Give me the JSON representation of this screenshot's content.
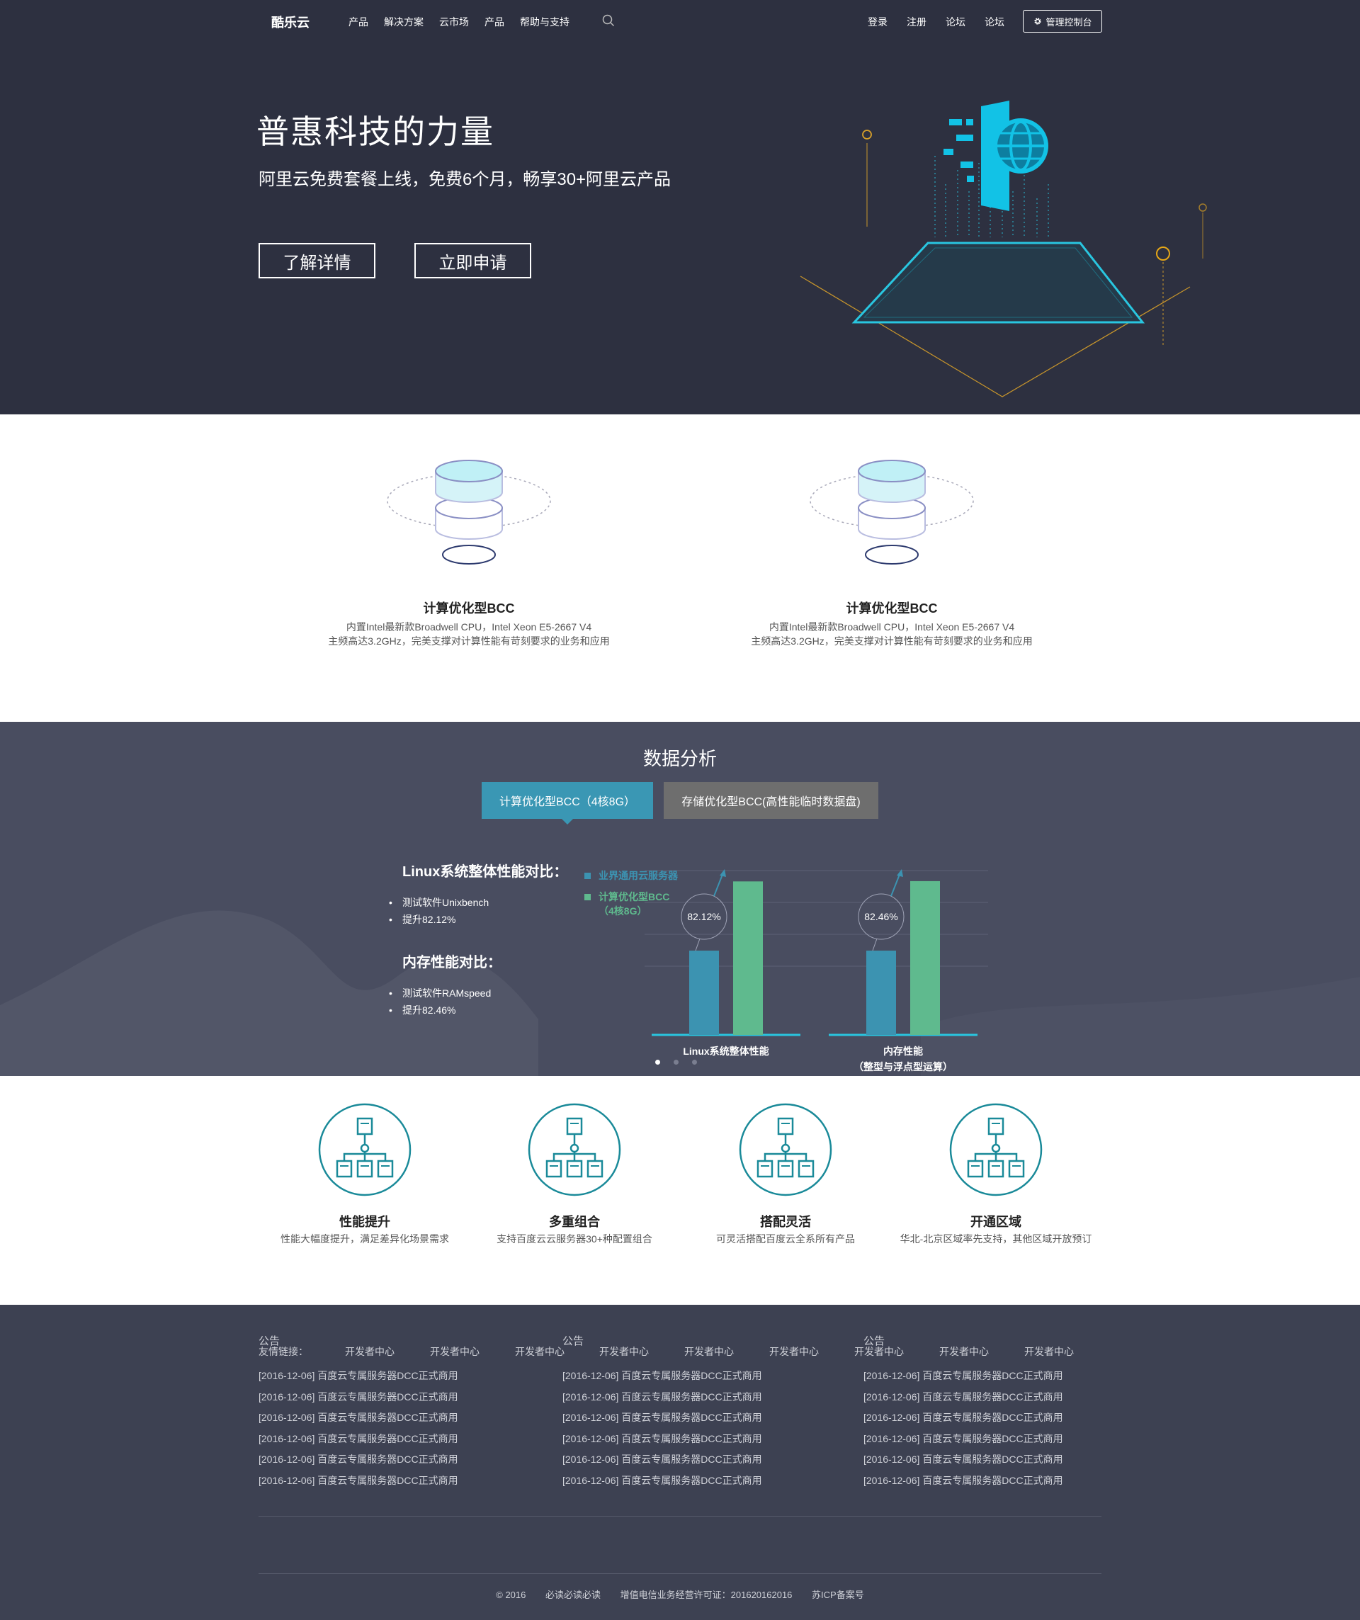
{
  "nav": {
    "logo": "酷乐云",
    "items": [
      "产品",
      "解决方案",
      "云市场",
      "产品",
      "帮助与支持"
    ],
    "right": [
      "登录",
      "注册",
      "论坛",
      "论坛"
    ],
    "console": "管理控制台"
  },
  "hero": {
    "title": "普惠科技的力量",
    "subtitle": "阿里云免费套餐上线，免费6个月，畅享30+阿里云产品",
    "btn_detail": "了解详情",
    "btn_apply": "立即申请"
  },
  "products": [
    {
      "title": "计算优化型BCC",
      "desc1": "内置Intel最新款Broadwell CPU，Intel Xeon E5-2667 V4",
      "desc2": "主频高达3.2GHz，完美支撑对计算性能有苛刻要求的业务和应用"
    },
    {
      "title": "计算优化型BCC",
      "desc1": "内置Intel最新款Broadwell CPU，Intel Xeon E5-2667 V4",
      "desc2": "主频高达3.2GHz，完美支撑对计算性能有苛刻要求的业务和应用"
    }
  ],
  "analysis": {
    "title": "数据分析",
    "tabs": [
      "计算优化型BCC（4核8G）",
      "存储优化型BCC(高性能临时数据盘)"
    ],
    "h1": "Linux系统整体性能对比：",
    "list1": [
      "测试软件Unixbench",
      "提升82.12%"
    ],
    "h2": "内存性能对比：",
    "list2": [
      "测试软件RAMspeed",
      "提升82.46%"
    ]
  },
  "chart_data": {
    "type": "bar",
    "categories": [
      "Linux系统整体性能",
      "内存性能（整型与浮点型运算）"
    ],
    "category_lines": [
      [
        "Linux系统整体性能"
      ],
      [
        "内存性能",
        "（整型与浮点型运算）"
      ]
    ],
    "series": [
      {
        "name": "业界通用云服务器",
        "values": [
          1.0,
          1.0
        ],
        "color": "#3c93b1"
      },
      {
        "name": "计算优化型BCC（4核8G）",
        "name_lines": [
          "计算优化型BCC",
          "（4核8G）"
        ],
        "values": [
          1.8212,
          1.8246
        ],
        "color": "#5fba8e"
      }
    ],
    "annotations": [
      "82.12%",
      "82.46%"
    ],
    "ylim": [
      0,
      1.95
    ],
    "grid": true,
    "legend": "top-left"
  },
  "features": [
    {
      "title": "性能提升",
      "desc": "性能大幅度提升，满足差异化场景需求"
    },
    {
      "title": "多重组合",
      "desc": "支持百度云云服务器30+种配置组合"
    },
    {
      "title": "搭配灵活",
      "desc": "可灵活搭配百度云全系所有产品"
    },
    {
      "title": "开通区域",
      "desc": "华北-北京区域率先支持，其他区域开放预订"
    }
  ],
  "footer": {
    "notices": [
      {
        "title": "公告",
        "items": [
          "[2016-12-06]  百度云专属服务器DCC正式商用",
          "[2016-12-06]  百度云专属服务器DCC正式商用",
          "[2016-12-06]  百度云专属服务器DCC正式商用",
          "[2016-12-06]  百度云专属服务器DCC正式商用",
          "[2016-12-06]  百度云专属服务器DCC正式商用",
          "[2016-12-06]  百度云专属服务器DCC正式商用"
        ]
      },
      {
        "title": "公告",
        "items": [
          "[2016-12-06]  百度云专属服务器DCC正式商用",
          "[2016-12-06]  百度云专属服务器DCC正式商用",
          "[2016-12-06]  百度云专属服务器DCC正式商用",
          "[2016-12-06]  百度云专属服务器DCC正式商用",
          "[2016-12-06]  百度云专属服务器DCC正式商用",
          "[2016-12-06]  百度云专属服务器DCC正式商用"
        ]
      },
      {
        "title": "公告",
        "items": [
          "[2016-12-06]  百度云专属服务器DCC正式商用",
          "[2016-12-06]  百度云专属服务器DCC正式商用",
          "[2016-12-06]  百度云专属服务器DCC正式商用",
          "[2016-12-06]  百度云专属服务器DCC正式商用",
          "[2016-12-06]  百度云专属服务器DCC正式商用",
          "[2016-12-06]  百度云专属服务器DCC正式商用"
        ]
      }
    ],
    "links_label": "友情链接：",
    "links": [
      "开发者中心",
      "开发者中心",
      "开发者中心",
      "开发者中心",
      "开发者中心",
      "开发者中心",
      "开发者中心",
      "开发者中心",
      "开发者中心"
    ],
    "copyright": "© 2016",
    "copy2": "必读必读必读",
    "license": "增值电信业务经营许可证：201620162016",
    "icp": "苏ICP备案号"
  },
  "colors": {
    "hero_bg": "#2d3040",
    "analysis_bg": "#494d60",
    "footer_bg": "#3d4152",
    "accent": "#3a97b4",
    "accent_green": "#5fba8e",
    "teal": "#1a8a99"
  }
}
